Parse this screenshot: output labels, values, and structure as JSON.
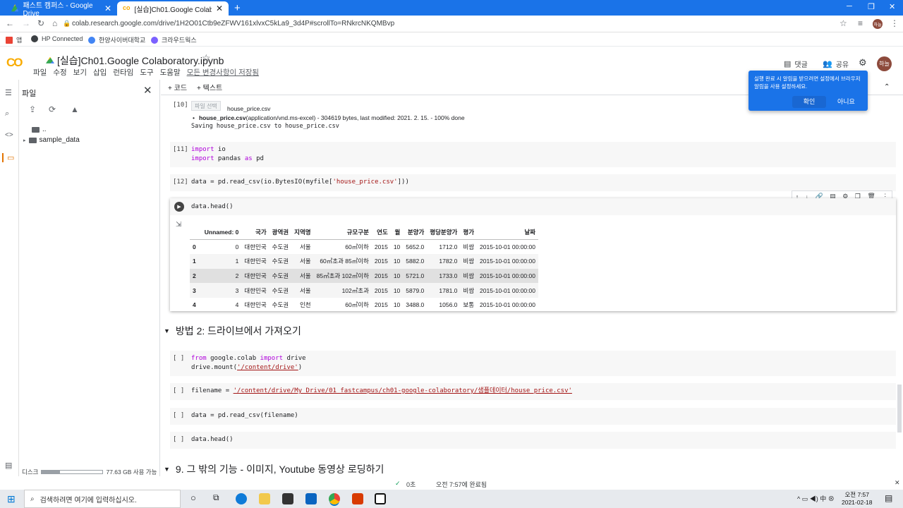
{
  "browser": {
    "tabs": [
      {
        "title": "패스트 캠퍼스 - Google Drive",
        "active": false
      },
      {
        "title": "[실습]Ch01.Google Colaboratory",
        "active": true
      }
    ],
    "new_tab": "+",
    "url": "colab.research.google.com/drive/1H2O01Ctb9eZFWV161xlvxC5kLa9_3d4P#scrollTo=RNkrcNKQMBvp",
    "bookmarks": [
      "앱",
      "HP Connected",
      "한양사이버대학교",
      "크라우드웍스"
    ],
    "profile_initials": "하늘"
  },
  "colab": {
    "logo": "CO",
    "notebook_title": "[실습]Ch01.Google Colaboratory.ipynb",
    "menu": [
      "파일",
      "수정",
      "보기",
      "삽입",
      "런타임",
      "도구",
      "도움말"
    ],
    "saved_status": "모든 변경사항이 저장됨",
    "comment_label": "댓글",
    "share_label": "공유",
    "avatar": "하늘",
    "toolbar": {
      "add_code": "+ 코드",
      "add_text": "+ 텍스트"
    }
  },
  "popup": {
    "message": "실행 완료 시 알림을 받으려면 설정에서 브라우저 알림을 사용 설정하세요.",
    "ok": "확인",
    "no": "아니요"
  },
  "files_panel": {
    "title": "파일",
    "items": [
      "..",
      "sample_data"
    ],
    "disk_label": "디스크",
    "disk_usage_text": "77.63 GB 사용 가능",
    "disk_fill_fraction": 0.3
  },
  "cells": {
    "c10": {
      "number": "[10]",
      "file_button": "파일 선택",
      "file_name": "house_price.csv",
      "bullet_name": "house_price.csv",
      "bullet_detail": "(application/vnd.ms-excel) - 304619 bytes, last modified: 2021. 2. 15. - 100% done",
      "saving": "Saving house_price.csv to house_price.csv"
    },
    "c11": {
      "number": "[11]",
      "line1_kw": "import",
      "line1_rest": " io",
      "line2_kw": "import",
      "line2_mid": " pandas ",
      "line2_kw2": "as",
      "line2_rest": " pd"
    },
    "c12": {
      "number": "[12]",
      "code_a": "data = pd.read_csv(io.BytesIO(myfile[",
      "code_str": "'house_price.csv'",
      "code_b": "]))"
    },
    "c13": {
      "code": "data.head()"
    },
    "c_drive1": {
      "number": "[ ]",
      "kw1": "from",
      "mid": " google.colab ",
      "kw2": "import",
      "rest": " drive",
      "line2_a": "drive.mount(",
      "line2_str": "'/content/drive'",
      "line2_b": ")"
    },
    "c_drive2": {
      "number": "[ ]",
      "code_a": "filename = ",
      "code_str": "'/content/drive/My Drive/01_fastcampus/ch01-google-colaboratory/샘플데이터/house_price.csv'"
    },
    "c_drive3": {
      "number": "[ ]",
      "code": "data = pd.read_csv(filename)"
    },
    "c_drive4": {
      "number": "[ ]",
      "code": "data.head()"
    }
  },
  "dataframe": {
    "columns": [
      "",
      "Unnamed: 0",
      "국가",
      "광역권",
      "지역명",
      "규모구분",
      "연도",
      "월",
      "분양가",
      "평당분양가",
      "평가",
      "날짜"
    ],
    "rows": [
      [
        "0",
        "0",
        "대한민국",
        "수도권",
        "서울",
        "60㎡이하",
        "2015",
        "10",
        "5652.0",
        "1712.0",
        "비쌈",
        "2015-10-01 00:00:00"
      ],
      [
        "1",
        "1",
        "대한민국",
        "수도권",
        "서울",
        "60㎡초과 85㎡이하",
        "2015",
        "10",
        "5882.0",
        "1782.0",
        "비쌈",
        "2015-10-01 00:00:00"
      ],
      [
        "2",
        "2",
        "대한민국",
        "수도권",
        "서울",
        "85㎡초과 102㎡이하",
        "2015",
        "10",
        "5721.0",
        "1733.0",
        "비쌈",
        "2015-10-01 00:00:00"
      ],
      [
        "3",
        "3",
        "대한민국",
        "수도권",
        "서울",
        "102㎡초과",
        "2015",
        "10",
        "5879.0",
        "1781.0",
        "비쌈",
        "2015-10-01 00:00:00"
      ],
      [
        "4",
        "4",
        "대한민국",
        "수도권",
        "인천",
        "60㎡이하",
        "2015",
        "10",
        "3488.0",
        "1056.0",
        "보통",
        "2015-10-01 00:00:00"
      ]
    ]
  },
  "sections": {
    "method2": "방법 2: 드라이브에서 가져오기",
    "other": "9. 그 밖의 기능 - 이미지, Youtube 동영상 로딩하기"
  },
  "statusbar": {
    "check": "✓",
    "time": "0초",
    "completed": "오전 7:57에 완료됨"
  },
  "taskbar": {
    "search_placeholder": "검색하려면 여기에 입력하십시오.",
    "time": "오전 7:57",
    "date": "2021-02-18"
  }
}
